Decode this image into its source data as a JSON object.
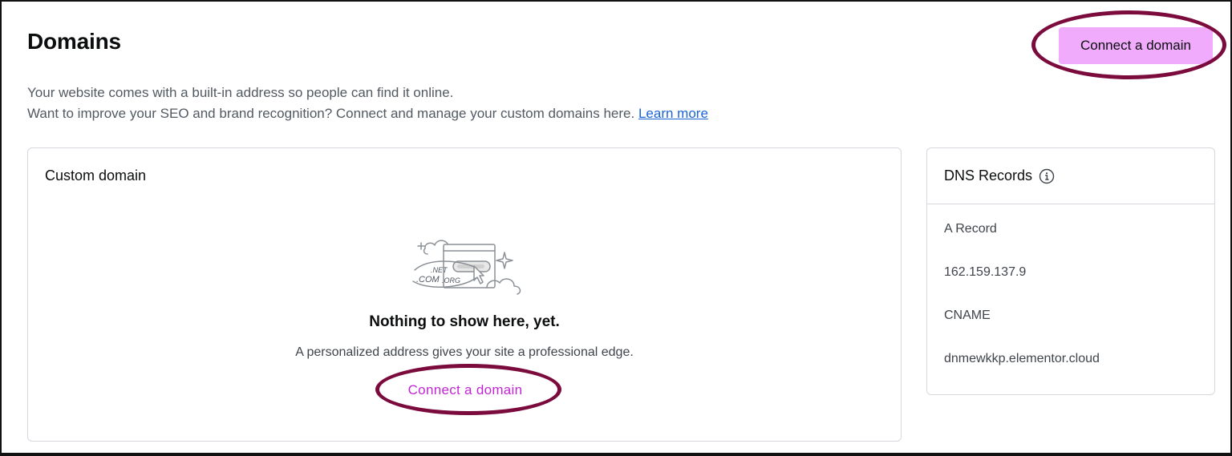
{
  "header": {
    "title": "Domains",
    "connect_button": "Connect a domain"
  },
  "description": {
    "line1": "Your website comes with a built-in address so people can find it online.",
    "line2": "Want to improve your SEO and brand recognition? Connect and manage your custom domains here.",
    "learn_more": "Learn more"
  },
  "custom_domain": {
    "title": "Custom domain",
    "illustration_labels": [
      ".NET",
      ".COM",
      ".ORG"
    ],
    "empty_title": "Nothing to show here, yet.",
    "empty_subtitle": "A personalized address gives your site a professional edge.",
    "connect_link": "Connect a domain"
  },
  "dns_records": {
    "title": "DNS Records",
    "a_record_label": "A Record",
    "a_record_value": "162.159.137.9",
    "cname_label": "CNAME",
    "cname_value": "dnmewkkp.elementor.cloud"
  },
  "colors": {
    "accent_button_bg": "#f0abfc",
    "accent_link": "#c026d3",
    "annotation_ellipse": "#7b0b3c",
    "learn_more_link": "#1a64d6"
  },
  "icons": {
    "info": "info-icon",
    "illustration": "domain-browser-illustration"
  }
}
